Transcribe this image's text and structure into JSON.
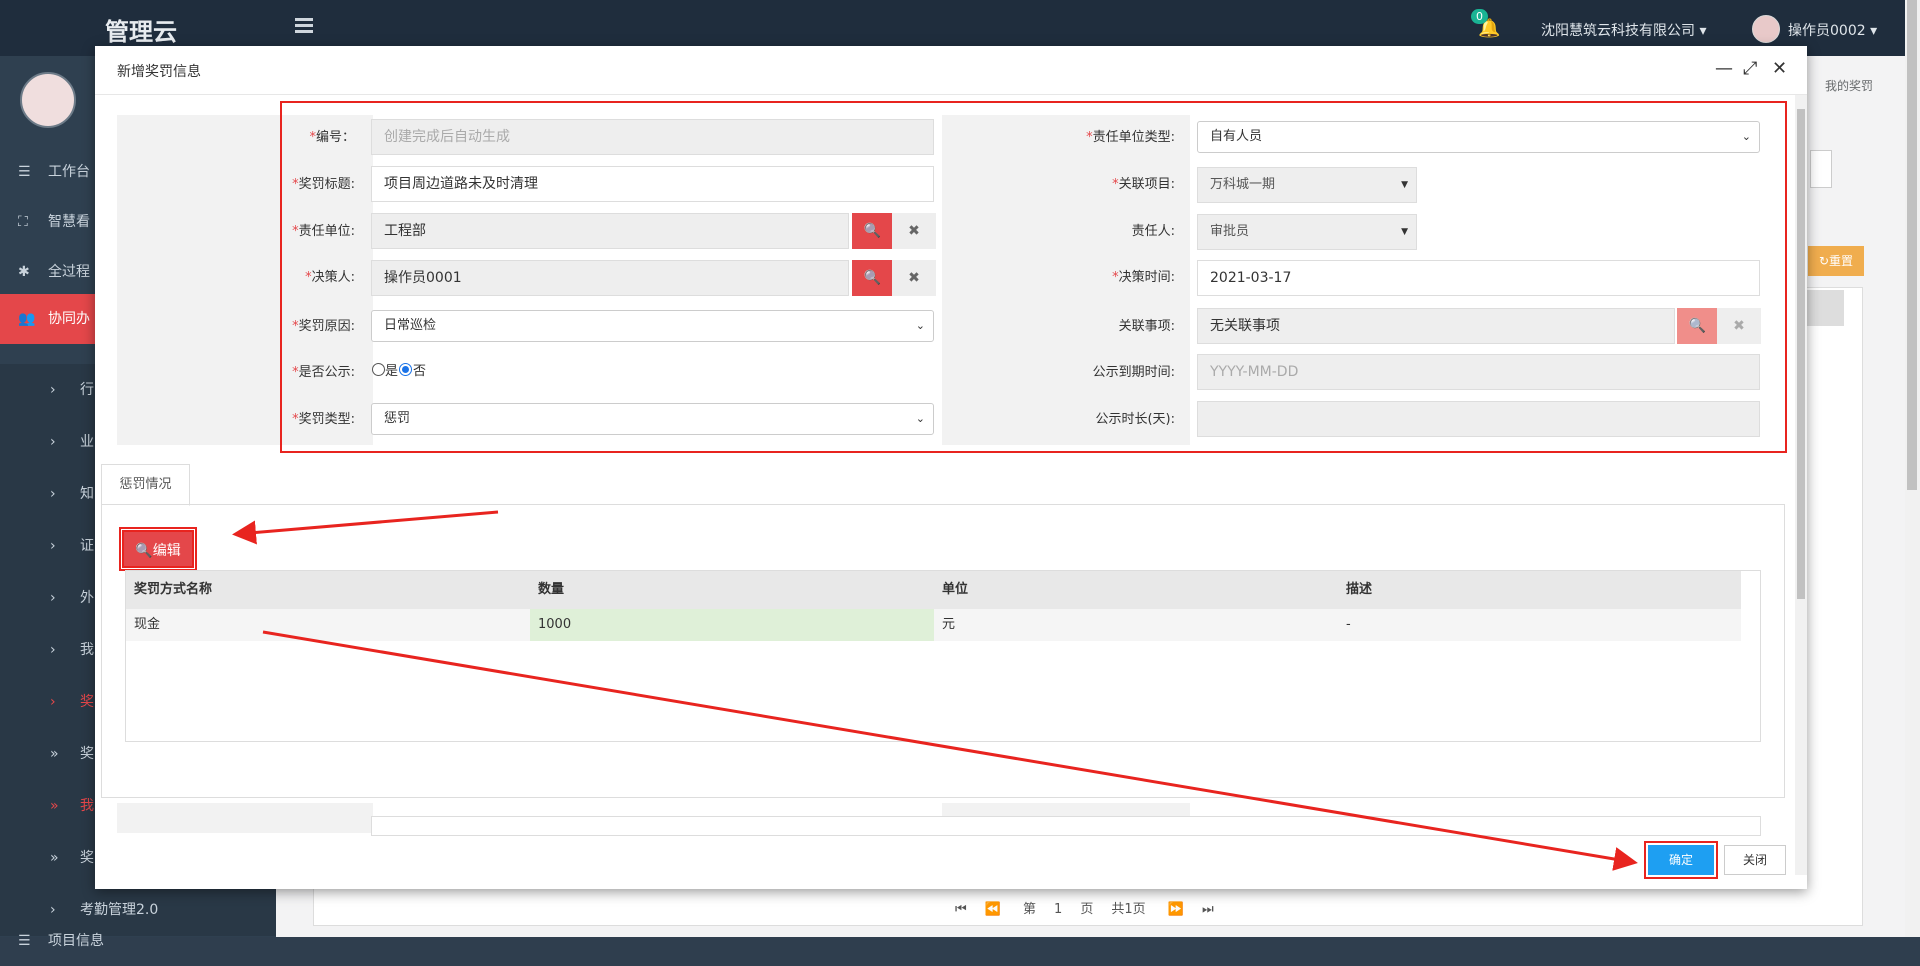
{
  "app": {
    "brand": "管理云"
  },
  "topbar": {
    "notify_count": "0",
    "company": "沈阳慧筑云科技有限公司",
    "user": "操作员0002"
  },
  "sidebar": {
    "items": [
      {
        "label": "工作台",
        "icon": "list-icon"
      },
      {
        "label": "智慧看",
        "icon": "dashboard-icon"
      },
      {
        "label": "全过程",
        "icon": "asterisk-icon"
      },
      {
        "label": "协同办",
        "icon": "users-icon"
      }
    ],
    "subitems": [
      {
        "label": "行",
        "icon": "chevron-right-icon"
      },
      {
        "label": "业",
        "icon": "chevron-right-icon"
      },
      {
        "label": "知",
        "icon": "chevron-right-icon"
      },
      {
        "label": "证",
        "icon": "chevron-right-icon"
      },
      {
        "label": "外",
        "icon": "chevron-right-icon"
      },
      {
        "label": "我",
        "icon": "chevron-right-icon"
      },
      {
        "label": "奖",
        "icon": "chevron-right-icon"
      },
      {
        "label": "奖",
        "icon": "double-chevron-right-icon"
      },
      {
        "label": "我",
        "icon": "double-chevron-right-icon"
      },
      {
        "label": "奖",
        "icon": "double-chevron-right-icon"
      },
      {
        "label": "考勤管理2.0",
        "icon": "chevron-right-icon"
      },
      {
        "label": "项目信息",
        "icon": "list-icon"
      }
    ]
  },
  "background": {
    "breadcrumb": "我的奖罚",
    "reset": "重置",
    "pager": {
      "page_label": "第",
      "page": "1",
      "page_unit": "页",
      "total": "共1页"
    }
  },
  "modal": {
    "title": "新增奖罚信息",
    "form": {
      "code": {
        "label": "编号：",
        "placeholder": "创建完成后自动生成"
      },
      "title": {
        "label": "奖罚标题:",
        "value": "项目周边道路未及时清理"
      },
      "unit": {
        "label": "责任单位:",
        "value": "工程部"
      },
      "decider": {
        "label": "决策人:",
        "value": "操作员0001"
      },
      "reason": {
        "label": "奖罚原因:",
        "value": "日常巡检"
      },
      "public": {
        "label": "是否公示:",
        "yes": "是",
        "no": "否",
        "selected": "否"
      },
      "type": {
        "label": "奖罚类型:",
        "value": "惩罚"
      },
      "unit_type": {
        "label": "责任单位类型:",
        "value": "自有人员"
      },
      "project": {
        "label": "关联项目:",
        "value": "万科城一期"
      },
      "responsible": {
        "label": "责任人:",
        "value": "审批员"
      },
      "decision_time": {
        "label": "决策时间:",
        "value": "2021-03-17"
      },
      "related": {
        "label": "关联事项:",
        "value": "无关联事项"
      },
      "expire": {
        "label": "公示到期时间:",
        "placeholder": "YYYY-MM-DD"
      },
      "duration": {
        "label": "公示时长(天):",
        "value": ""
      }
    },
    "tab": "惩罚情况",
    "edit_button": "编辑",
    "table": {
      "headers": [
        "奖罚方式名称",
        "数量",
        "单位",
        "描述"
      ],
      "rows": [
        [
          "现金",
          "1000",
          "元",
          "-"
        ]
      ]
    },
    "confirm": "确定",
    "close": "关闭"
  },
  "colors": {
    "accent_red": "#e4474a",
    "confirm_blue": "#1e9ff2",
    "annotation_red": "#e8241f"
  }
}
